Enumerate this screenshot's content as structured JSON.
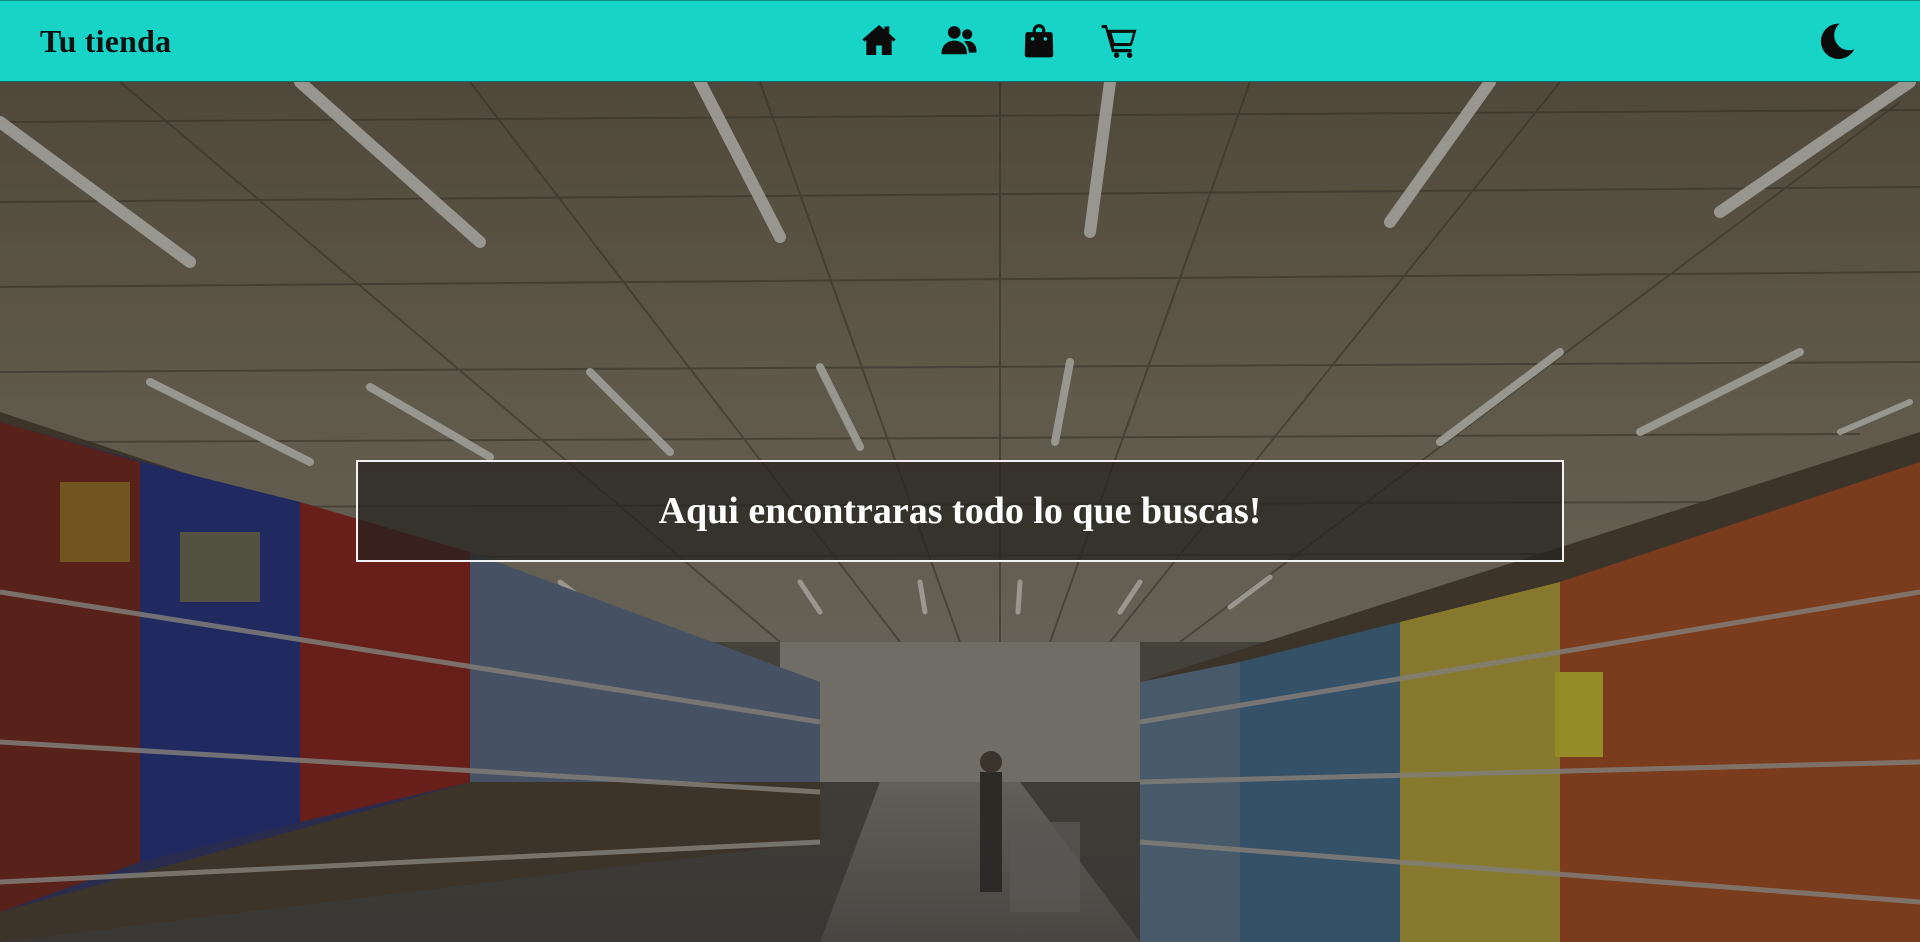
{
  "navbar": {
    "brand": "Tu tienda",
    "icons": [
      {
        "name": "home-icon"
      },
      {
        "name": "users-icon"
      },
      {
        "name": "shopping-bag-icon"
      },
      {
        "name": "cart-icon"
      }
    ],
    "theme_icon": "moon-icon",
    "background_color": "#17d4c6"
  },
  "hero": {
    "headline": "Aqui encontraras todo lo que buscas!"
  }
}
